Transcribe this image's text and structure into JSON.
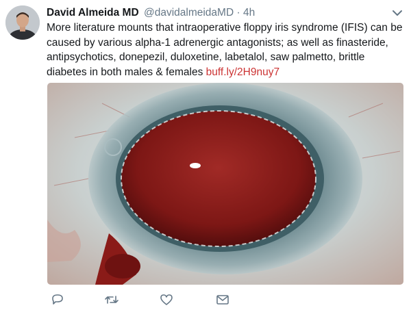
{
  "tweet": {
    "author_name": "David Almeida MD",
    "handle": "@davidalmeidaMD",
    "separator": "·",
    "time": "4h",
    "text": "More literature mounts that intraoperative floppy iris syndrome (IFIS) can be caused by various alpha-1 adrenergic antagonists; as well as finasteride, antipsychotics, donepezil, duloxetine, labetalol, saw palmetto, brittle diabetes in both males & females",
    "link": "buff.ly/2H9nuy7",
    "icons": {
      "menu": "chevron-down-icon",
      "reply": "reply-icon",
      "retweet": "retweet-icon",
      "like": "heart-icon",
      "message": "envelope-icon"
    },
    "colors": {
      "link": "#cc3333",
      "secondary": "#657786",
      "icon": "#657786"
    }
  }
}
